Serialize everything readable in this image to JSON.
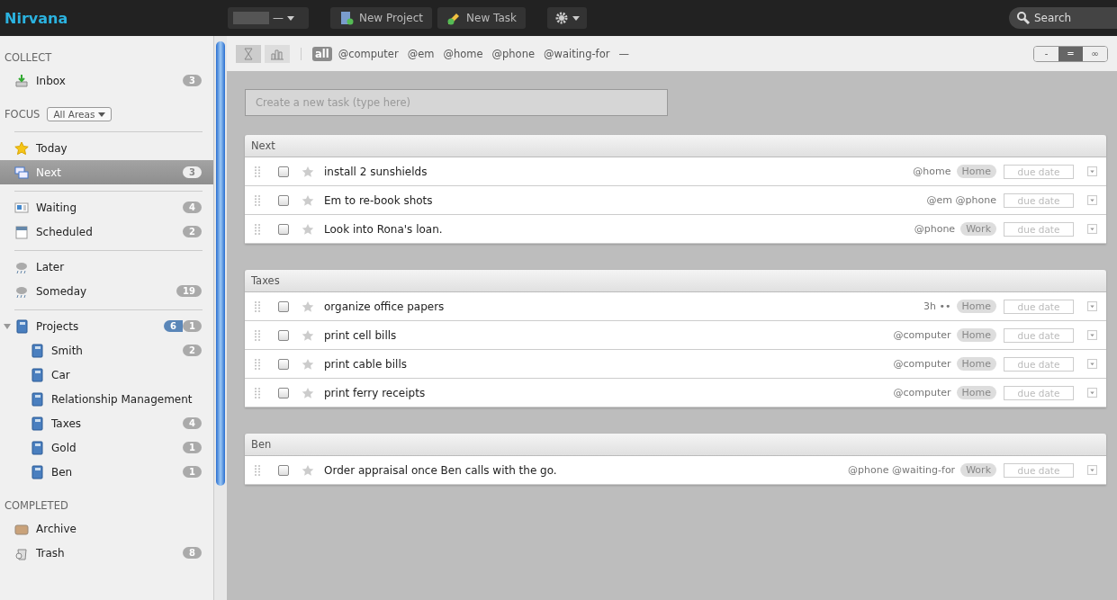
{
  "header": {
    "logo": "Nirvana",
    "account_menu": "—",
    "buttons": [
      {
        "label": "New Project",
        "kind": "project"
      },
      {
        "label": "New Task",
        "kind": "task"
      }
    ],
    "search": {
      "placeholder": "Search"
    }
  },
  "sidebar": {
    "sections": [
      {
        "title": "COLLECT",
        "items": [
          {
            "label": "Inbox",
            "kind": "inbox",
            "count": "3",
            "selected": false
          }
        ]
      },
      {
        "title": "FOCUS",
        "filter": "All Areas",
        "groups": [
          [
            {
              "label": "Today",
              "kind": "star",
              "selected": false
            },
            {
              "label": "Next",
              "kind": "next",
              "count": "3",
              "selected": true
            }
          ],
          [
            {
              "label": "Waiting",
              "kind": "waiting",
              "count": "4",
              "selected": false
            },
            {
              "label": "Scheduled",
              "kind": "calendar",
              "count": "2",
              "selected": false
            }
          ],
          [
            {
              "label": "Later",
              "kind": "cloud",
              "selected": false
            },
            {
              "label": "Someday",
              "kind": "cloud",
              "count": "19",
              "selected": false
            }
          ],
          [
            {
              "label": "Projects",
              "kind": "book",
              "count": "6",
              "count_2": "1",
              "expanded": true,
              "selected": false,
              "children": [
                {
                  "label": "Smith",
                  "kind": "book",
                  "count": "2",
                  "selected": false
                },
                {
                  "label": "Car",
                  "kind": "book",
                  "selected": false
                },
                {
                  "label": "Relationship Management",
                  "kind": "book",
                  "selected": false
                },
                {
                  "label": "Taxes",
                  "kind": "book",
                  "count": "4",
                  "selected": false
                },
                {
                  "label": "Gold",
                  "kind": "book",
                  "count": "1",
                  "selected": false
                },
                {
                  "label": "Ben",
                  "kind": "book",
                  "count": "1",
                  "selected": false
                }
              ]
            }
          ]
        ]
      },
      {
        "title": "COMPLETED",
        "items": [
          {
            "label": "Archive",
            "kind": "box",
            "selected": false
          },
          {
            "label": "Trash",
            "kind": "trash",
            "count": "8",
            "selected": false
          }
        ]
      }
    ]
  },
  "toolbar": {
    "views": [
      {
        "kind": "hourglass",
        "selected": true
      },
      {
        "kind": "chart",
        "selected": false
      }
    ],
    "contexts": [
      {
        "label": "all",
        "selected": true
      },
      {
        "label": "@computer",
        "selected": false
      },
      {
        "label": "@em",
        "selected": false
      },
      {
        "label": "@home",
        "selected": false
      },
      {
        "label": "@phone",
        "selected": false
      },
      {
        "label": "@waiting-for",
        "selected": false
      },
      {
        "label": "—",
        "selected": false
      }
    ],
    "density": [
      {
        "label": "-",
        "selected": false
      },
      {
        "label": "=",
        "selected": true
      },
      {
        "label": "∞",
        "selected": false
      }
    ]
  },
  "new_task": {
    "placeholder": "Create a new task (type here)"
  },
  "groups": [
    {
      "title": "Next",
      "tasks": [
        {
          "title": "install 2 sunshields",
          "contexts": "@home",
          "area": "Home",
          "checked": false,
          "starred": false,
          "due_placeholder": "due date"
        },
        {
          "title": "Em to re-book shots",
          "contexts": "@em @phone",
          "checked": false,
          "starred": false,
          "due_placeholder": "due date"
        },
        {
          "title": "Look into Rona's loan.",
          "contexts": "@phone",
          "area": "Work",
          "checked": false,
          "starred": false,
          "due_placeholder": "due date"
        }
      ]
    },
    {
      "title": "Taxes",
      "tasks": [
        {
          "title": "organize office papers",
          "contexts": "3h ••",
          "area": "Home",
          "checked": false,
          "starred": false,
          "due_placeholder": "due date"
        },
        {
          "title": "print cell bills",
          "contexts": "@computer",
          "area": "Home",
          "checked": false,
          "starred": false,
          "due_placeholder": "due date"
        },
        {
          "title": "print cable bills",
          "contexts": "@computer",
          "area": "Home",
          "checked": false,
          "starred": false,
          "due_placeholder": "due date"
        },
        {
          "title": "print ferry receipts",
          "contexts": "@computer",
          "area": "Home",
          "checked": false,
          "starred": false,
          "due_placeholder": "due date"
        }
      ]
    },
    {
      "title": "Ben",
      "tasks": [
        {
          "title": "Order appraisal once Ben calls with the go.",
          "contexts": "@phone @waiting-for",
          "area": "Work",
          "checked": false,
          "starred": false,
          "due_placeholder": "due date"
        }
      ]
    }
  ]
}
